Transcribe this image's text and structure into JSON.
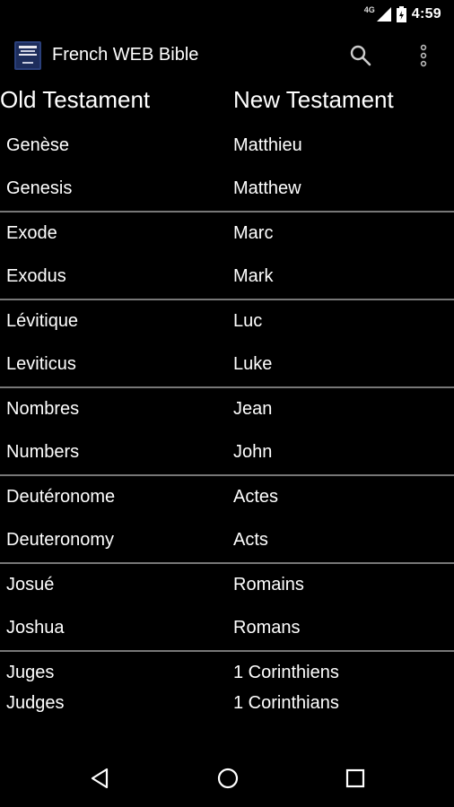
{
  "status_bar": {
    "network": "4G",
    "time": "4:59"
  },
  "app_bar": {
    "title": "French WEB Bible",
    "icon": "bible-book-icon",
    "search_icon": "search-icon",
    "overflow_icon": "overflow-menu-icon"
  },
  "columns": {
    "old": "Old Testament",
    "new": "New Testament"
  },
  "book_pairs": [
    {
      "ot_fr": "Genèse",
      "ot_en": "Genesis",
      "nt_fr": "Matthieu",
      "nt_en": "Matthew"
    },
    {
      "ot_fr": "Exode",
      "ot_en": "Exodus",
      "nt_fr": "Marc",
      "nt_en": "Mark"
    },
    {
      "ot_fr": "Lévitique",
      "ot_en": "Leviticus",
      "nt_fr": "Luc",
      "nt_en": "Luke"
    },
    {
      "ot_fr": "Nombres",
      "ot_en": "Numbers",
      "nt_fr": "Jean",
      "nt_en": "John"
    },
    {
      "ot_fr": "Deutéronome",
      "ot_en": "Deuteronomy",
      "nt_fr": "Actes",
      "nt_en": "Acts"
    },
    {
      "ot_fr": "Josué",
      "ot_en": "Joshua",
      "nt_fr": "Romains",
      "nt_en": "Romans"
    },
    {
      "ot_fr": "Juges",
      "ot_en": "Judges",
      "nt_fr": "1 Corinthiens",
      "nt_en": "1 Corinthians"
    }
  ],
  "nav_bar": {
    "back": "back-icon",
    "home": "home-icon",
    "recents": "recents-icon"
  }
}
